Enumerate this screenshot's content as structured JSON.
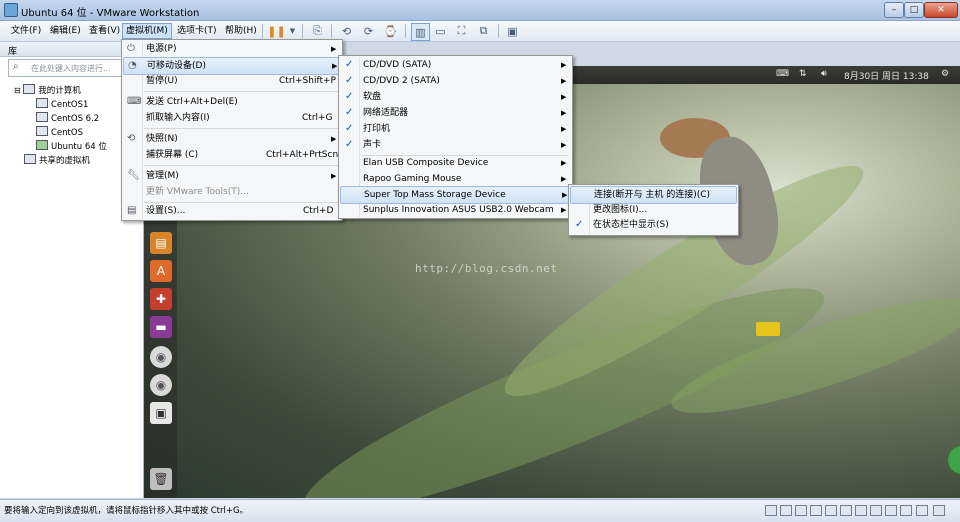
{
  "window": {
    "title": "Ubuntu 64 位 - VMware Workstation",
    "controls": [
      "minimize",
      "maximize",
      "close"
    ]
  },
  "menubar": [
    "文件(F)",
    "编辑(E)",
    "查看(V)",
    "虚拟机(M)",
    "选项卡(T)",
    "帮助(H)"
  ],
  "library": {
    "header": "库",
    "search_placeholder": "在此处键入内容进行...",
    "root": "我的计算机",
    "vms": [
      "CentOS1",
      "CentOS 6.2",
      "CentOS",
      "Ubuntu 64 位"
    ],
    "shared": "共享的虚拟机"
  },
  "vm_menu": {
    "items": [
      {
        "label": "电源(P)",
        "shortcut": "",
        "submenu": true,
        "icon": "power-icon"
      },
      {
        "label": "可移动设备(D)",
        "shortcut": "",
        "submenu": true,
        "icon": "removable-device-icon",
        "highlighted": true
      },
      {
        "label": "暂停(U)",
        "shortcut": "Ctrl+Shift+P",
        "submenu": false
      },
      {
        "label": "发送 Ctrl+Alt+Del(E)",
        "shortcut": "",
        "submenu": false,
        "icon": "keyboard-icon"
      },
      {
        "label": "抓取输入内容(I)",
        "shortcut": "Ctrl+G",
        "submenu": false
      },
      {
        "label": "快照(N)",
        "shortcut": "",
        "submenu": true,
        "icon": "snapshot-icon"
      },
      {
        "label": "捕获屏幕 (C)",
        "shortcut": "Ctrl+Alt+PrtScn",
        "submenu": false
      },
      {
        "label": "管理(M)",
        "shortcut": "",
        "submenu": true,
        "icon": "wrench-icon"
      },
      {
        "label": "更新 VMware Tools(T)...",
        "shortcut": "",
        "submenu": false,
        "disabled": true
      },
      {
        "label": "设置(S)...",
        "shortcut": "Ctrl+D",
        "submenu": false,
        "icon": "settings-icon"
      }
    ]
  },
  "devices_menu": {
    "items": [
      {
        "label": "CD/DVD (SATA)",
        "checked": true
      },
      {
        "label": "CD/DVD 2 (SATA)",
        "checked": true
      },
      {
        "label": "软盘",
        "checked": true
      },
      {
        "label": "网络适配器",
        "checked": true
      },
      {
        "label": "打印机",
        "checked": true
      },
      {
        "label": "声卡",
        "checked": true
      },
      {
        "label": "Elan USB Composite Device",
        "checked": false
      },
      {
        "label": "Rapoo Gaming Mouse",
        "checked": false
      },
      {
        "label": "Super Top Mass Storage Device",
        "checked": false,
        "highlighted": true
      },
      {
        "label": "Sunplus Innovation ASUS USB2.0 Webcam",
        "checked": false
      }
    ]
  },
  "usb_menu": {
    "items": [
      {
        "label": "连接(断开与 主机 的连接)(C)",
        "checked": false,
        "highlighted": true
      },
      {
        "label": "更改图标(I)...",
        "checked": false
      },
      {
        "label": "在状态栏中显示(S)",
        "checked": true
      }
    ]
  },
  "guest_panel": {
    "datetime": "8月30日 周日 13:38"
  },
  "watermark": "http://blog.csdn.net",
  "statusbar": {
    "message": "要将输入定向到该虚拟机，请将鼠标指针移入其中或按 Ctrl+G。"
  },
  "colors": {
    "accent": "#cde2f7",
    "menu_bg": "#f5f6f7",
    "panel_bg": "#2f2e2b",
    "check": "#1a4f99"
  }
}
